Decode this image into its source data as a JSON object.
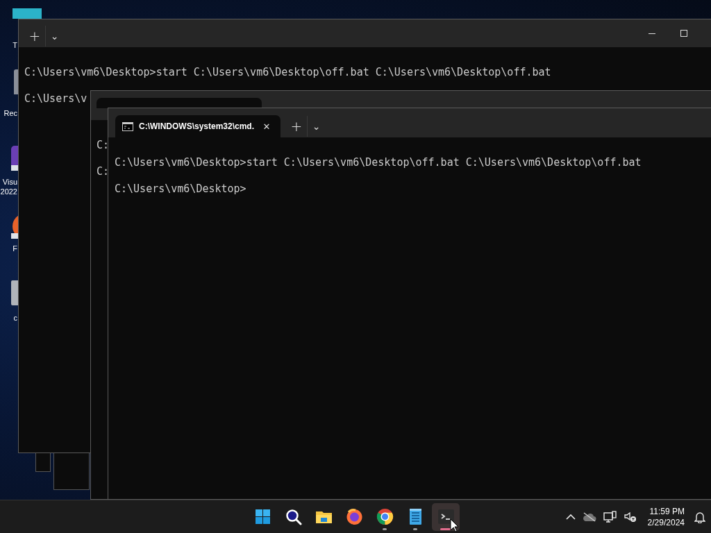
{
  "desktop_icons": [
    {
      "kind": "teal",
      "lines": [
        "T"
      ]
    },
    {
      "kind": "bin",
      "lines": [
        "Rec"
      ]
    },
    {
      "kind": "vs",
      "lines": [
        "Visu",
        "2022"
      ]
    },
    {
      "kind": "fox",
      "lines": [
        "F"
      ]
    },
    {
      "kind": "gray",
      "lines": [
        "c"
      ]
    }
  ],
  "windows": [
    {
      "new_tab": "+",
      "dropdown": "⌄",
      "controls": [
        {
          "kind": "minimize"
        },
        {
          "kind": "maximize"
        }
      ],
      "lines": [
        "C:\\Users\\vm6\\Desktop>start C:\\Users\\vm6\\Desktop\\off.bat C:\\Users\\vm6\\Desktop\\off.bat",
        "C:\\Users\\v"
      ]
    },
    {
      "tab": {
        "kind": "stub"
      },
      "lines": [
        "C:",
        "C:"
      ]
    },
    {
      "tab": {
        "kind": "full",
        "label": "C:\\WINDOWS\\system32\\cmd.",
        "close": "✕"
      },
      "new_tab": "+",
      "dropdown": "⌄",
      "lines": [
        "C:\\Users\\vm6\\Desktop>start C:\\Users\\vm6\\Desktop\\off.bat C:\\Users\\vm6\\Desktop\\off.bat",
        "C:\\Users\\vm6\\Desktop>"
      ]
    }
  ],
  "taskbar": {
    "apps": [
      {
        "kind": "start",
        "running": false,
        "selected": false
      },
      {
        "kind": "search",
        "running": false,
        "selected": false
      },
      {
        "kind": "files",
        "running": false,
        "selected": false
      },
      {
        "kind": "firefox",
        "running": false,
        "selected": false
      },
      {
        "kind": "chrome",
        "running": true,
        "selected": false
      },
      {
        "kind": "notepad",
        "running": true,
        "selected": false
      },
      {
        "kind": "terminal",
        "running": true,
        "selected": true
      }
    ],
    "tray": {
      "time": "11:59 PM",
      "date": "2/29/2024"
    }
  }
}
